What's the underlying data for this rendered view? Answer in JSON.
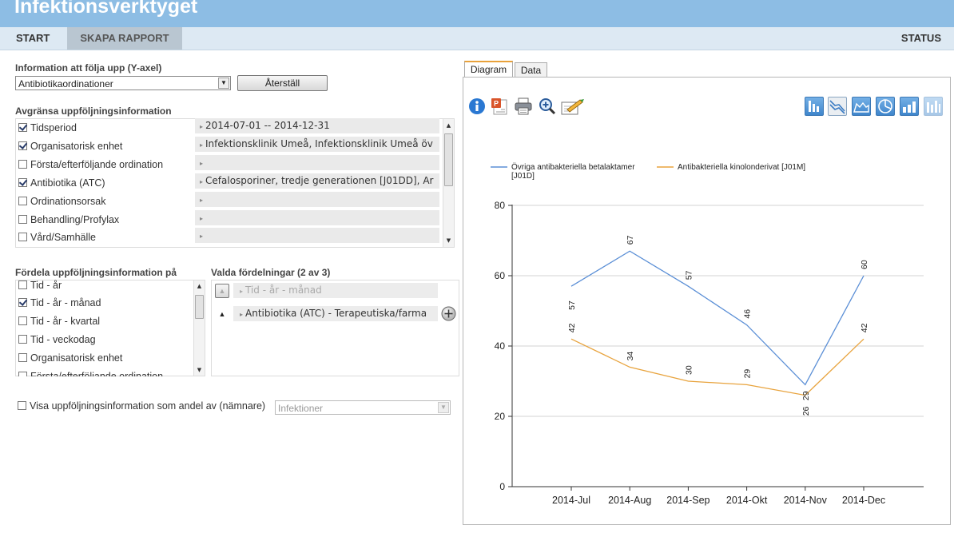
{
  "app": {
    "title": "Infektionsverktyget"
  },
  "nav": {
    "start": "START",
    "rapport": "SKAPA RAPPORT",
    "status": "STATUS"
  },
  "yaxis": {
    "label": "Information att följa upp (Y-axel)",
    "selected": "Antibiotikaordinationer",
    "reset_label": "Återställ"
  },
  "limits": {
    "label": "Avgränsa uppföljningsinformation",
    "items": [
      {
        "label": "Tidsperiod",
        "checked": true,
        "value": "2014-07-01 -- 2014-12-31"
      },
      {
        "label": "Organisatorisk enhet",
        "checked": true,
        "value": "Infektionsklinik Umeå, Infektionsklinik Umeå öv"
      },
      {
        "label": "Första/efterföljande ordination",
        "checked": false,
        "value": ""
      },
      {
        "label": "Antibiotika (ATC)",
        "checked": true,
        "value": "Cefalosporiner, tredje generationen [J01DD], Ar"
      },
      {
        "label": "Ordinationsorsak",
        "checked": false,
        "value": ""
      },
      {
        "label": "Behandling/Profylax",
        "checked": false,
        "value": ""
      },
      {
        "label": "Vård/Samhälle",
        "checked": false,
        "value": ""
      }
    ]
  },
  "distribute": {
    "label": "Fördela uppföljningsinformation på",
    "items": [
      {
        "label": "Tid - år",
        "checked": false
      },
      {
        "label": "Tid - år - månad",
        "checked": true
      },
      {
        "label": "Tid - år - kvartal",
        "checked": false
      },
      {
        "label": "Tid - veckodag",
        "checked": false
      },
      {
        "label": "Organisatorisk enhet",
        "checked": false
      },
      {
        "label": "Första/efterföljande ordination",
        "checked": false
      }
    ]
  },
  "chosen": {
    "label": "Valda fördelningar (2 av 3)",
    "items": [
      {
        "label": "Tid - år - månad",
        "disabled": true
      },
      {
        "label": "Antibiotika (ATC) - Terapeutiska/farma",
        "disabled": false
      }
    ]
  },
  "denominator": {
    "label": "Visa uppföljningsinformation som andel av (nämnare)",
    "checked": false,
    "value": "Infektioner"
  },
  "tabs": {
    "diagram": "Diagram",
    "data": "Data"
  },
  "toolbar_icons": [
    "info-icon",
    "powerpoint-icon",
    "print-icon",
    "zoom-icon",
    "edit-icon"
  ],
  "chart_type_icons": [
    "bar-chart-icon",
    "line-chart-icon",
    "area-chart-icon",
    "pie-chart-icon",
    "column-chart-icon",
    "stacked-chart-icon"
  ],
  "chart_data": {
    "type": "line",
    "categories": [
      "2014-Jul",
      "2014-Aug",
      "2014-Sep",
      "2014-Okt",
      "2014-Nov",
      "2014-Dec"
    ],
    "series": [
      {
        "name": "Övriga antibakteriella betalaktamer [J01D]",
        "color": "#5b8fd6",
        "values": [
          57,
          67,
          57,
          46,
          29,
          60
        ]
      },
      {
        "name": "Antibakteriella kinolonderivat [J01M]",
        "color": "#e8a33d",
        "values": [
          42,
          34,
          30,
          29,
          26,
          42
        ]
      }
    ],
    "ylim": [
      0,
      80
    ],
    "yticks": [
      0,
      20,
      40,
      60,
      80
    ],
    "grid": true,
    "legend": "top"
  }
}
